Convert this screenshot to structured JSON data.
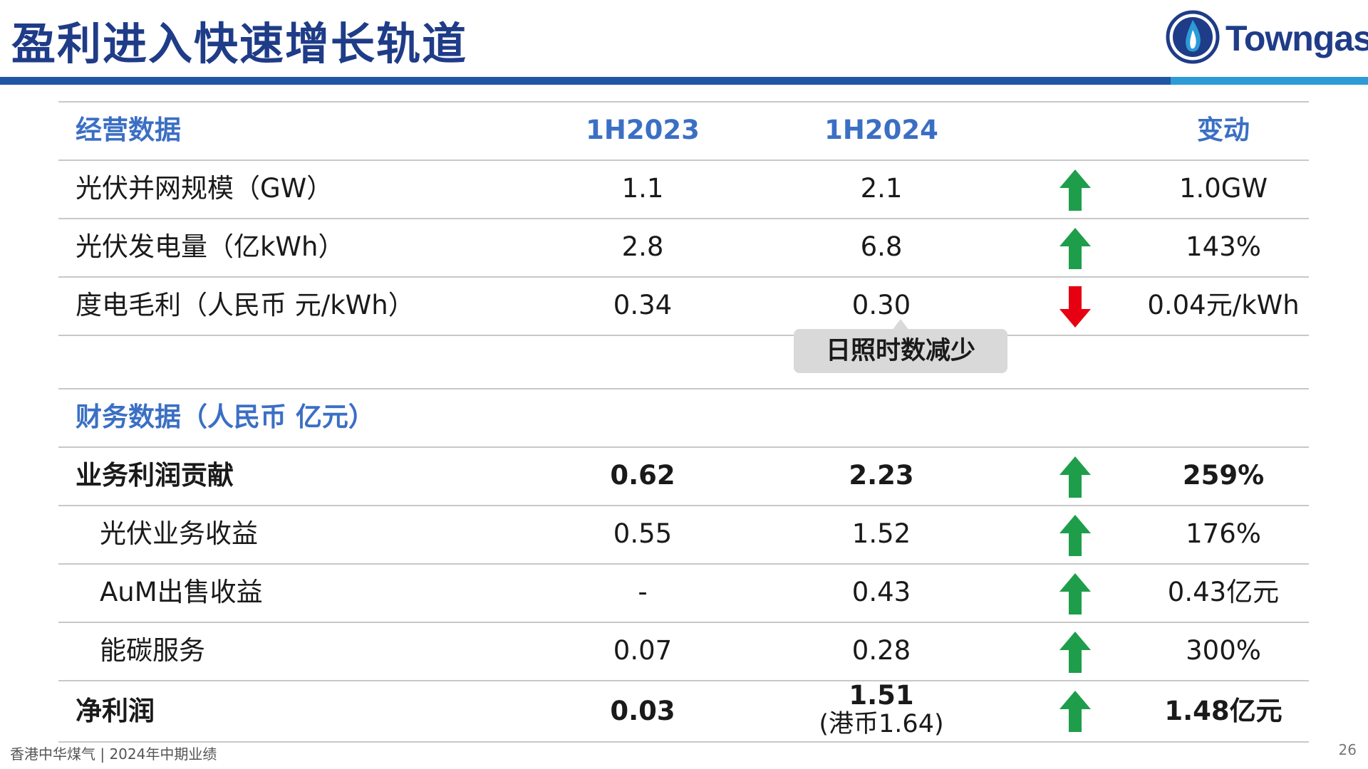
{
  "title": "盈利进入快速增长轨道",
  "logo": {
    "text": "Towngas",
    "colors": {
      "ring": "#1f3c88",
      "flame": "#2c9bd6"
    }
  },
  "colors": {
    "title": "#1f3c88",
    "header": "#3b6fc4",
    "up": "#1e9e4a",
    "down": "#e60012"
  },
  "operating": {
    "header": {
      "label": "经营数据",
      "col_a": "1H2023",
      "col_b": "1H2024",
      "col_change": "变动"
    },
    "rows": [
      {
        "label": "光伏并网规模（GW）",
        "a": "1.1",
        "b": "2.1",
        "direction": "up",
        "change": "1.0GW"
      },
      {
        "label": "光伏发电量（亿kWh）",
        "a": "2.8",
        "b": "6.8",
        "direction": "up",
        "change": "143%"
      },
      {
        "label": "度电毛利（人民币 元/kWh）",
        "a": "0.34",
        "b": "0.30",
        "direction": "down",
        "change": "0.04元/kWh"
      }
    ],
    "callout": "日照时数减少"
  },
  "financial": {
    "header": "财务数据（人民币 亿元）",
    "rows": [
      {
        "label": "业务利润贡献",
        "a": "0.62",
        "b": "2.23",
        "direction": "up",
        "change": "259%"
      },
      {
        "label": "光伏业务收益",
        "a": "0.55",
        "b": "1.52",
        "direction": "up",
        "change": "176%"
      },
      {
        "label": "AuM出售收益",
        "a": "-",
        "b": "0.43",
        "direction": "up",
        "change": "0.43亿元"
      },
      {
        "label": "能碳服务",
        "a": "0.07",
        "b": "0.28",
        "direction": "up",
        "change": "300%"
      }
    ],
    "net_profit": {
      "label": "净利润",
      "a": "0.03",
      "b": "1.51",
      "b_note": "(港币1.64)",
      "direction": "up",
      "change": "1.48亿元"
    }
  },
  "footer": "香港中华煤气 | 2024年中期业绩",
  "page_number": "26"
}
